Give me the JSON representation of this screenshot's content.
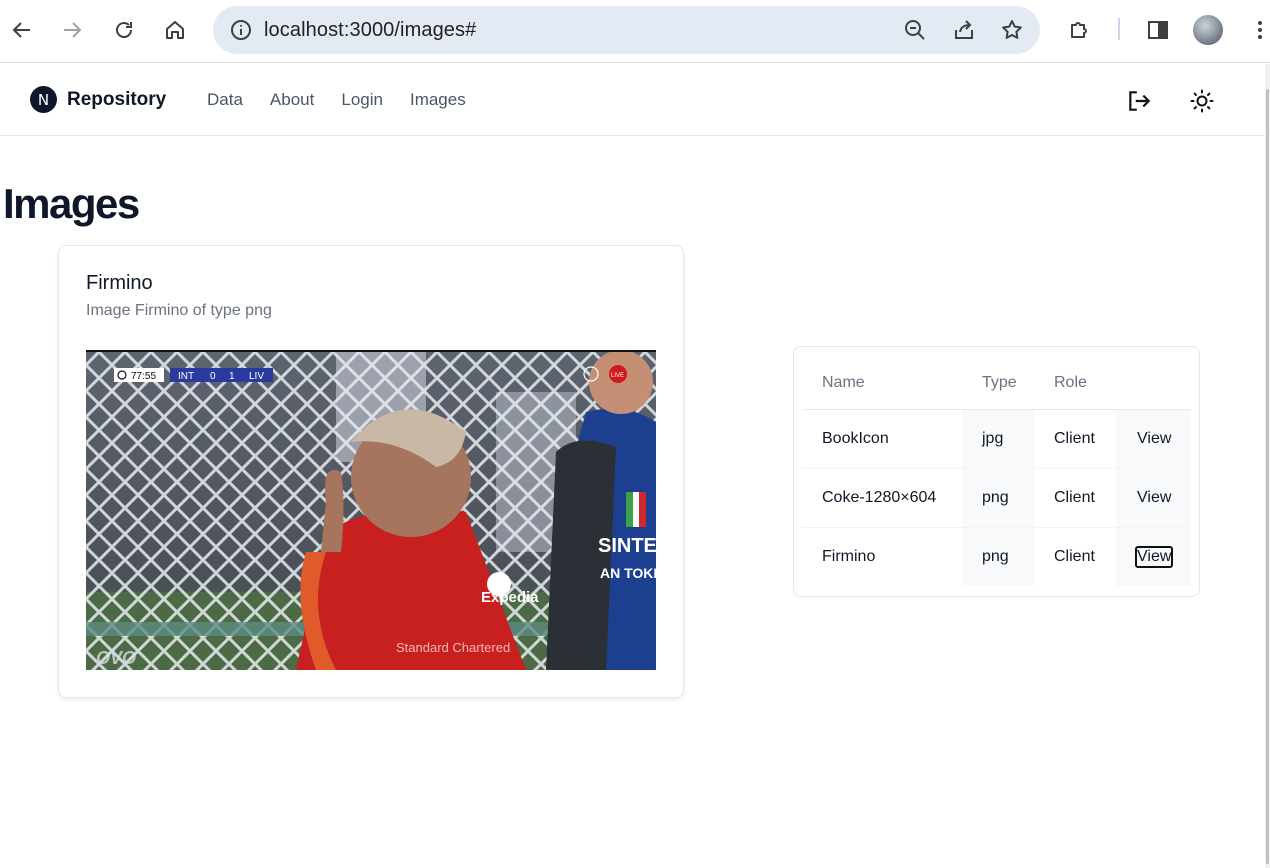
{
  "browser": {
    "url": "localhost:3000/images#",
    "icons": {
      "back": "back-arrow-icon",
      "forward": "forward-arrow-icon",
      "reload": "reload-icon",
      "home": "home-icon",
      "info": "info-icon",
      "zoom": "zoom-out-icon",
      "share": "share-icon",
      "bookmark": "star-icon",
      "extensions": "puzzle-icon",
      "sidepanel": "side-panel-icon",
      "menu": "kebab-menu-icon"
    }
  },
  "header": {
    "brand_logo": "N",
    "brand_name": "Repository",
    "nav": [
      "Data",
      "About",
      "Login",
      "Images"
    ],
    "logout_icon": "logout-icon",
    "theme_icon": "sun-icon"
  },
  "page": {
    "title": "Images"
  },
  "card": {
    "title": "Firmino",
    "description": "Image Firmino of type png",
    "photo": {
      "scoreboard": {
        "time": "77:55",
        "home": "INT",
        "home_score": "0",
        "away_score": "1",
        "away": "LIV"
      },
      "live_badge": "LIVE",
      "sponsor": "Expedia",
      "partner_logo": "SINTE",
      "partner_logo_2": "AN TOKE",
      "kit_text": "Standard Chartered",
      "watermark": "OVO"
    }
  },
  "table": {
    "headers": [
      "Name",
      "Type",
      "Role",
      ""
    ],
    "rows": [
      {
        "name": "BookIcon",
        "type": "jpg",
        "role": "Client",
        "action": "View"
      },
      {
        "name": "Coke-1280×604",
        "type": "png",
        "role": "Client",
        "action": "View"
      },
      {
        "name": "Firmino",
        "type": "png",
        "role": "Client",
        "action": "View"
      }
    ]
  }
}
